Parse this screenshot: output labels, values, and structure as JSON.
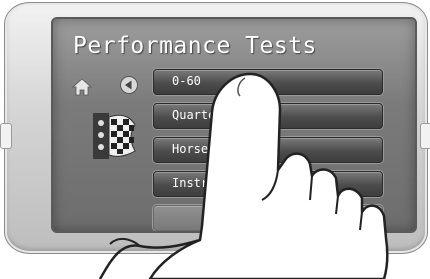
{
  "screen": {
    "title": "Performance Tests"
  },
  "nav": {
    "home_icon": "home-icon",
    "back_icon": "back-arrow-icon",
    "logo_icon": "checkered-flag-logo-icon"
  },
  "menu": {
    "items": [
      {
        "label": "0-60"
      },
      {
        "label": "Quarter M"
      },
      {
        "label": "Horsepo"
      },
      {
        "label": "Instruc"
      },
      {
        "label": ""
      }
    ]
  },
  "colors": {
    "screen_bg": "#7b7b7b",
    "button_bg": "#4c4c4c",
    "text": "#ffffff",
    "bezel": "#d4d4d4"
  }
}
